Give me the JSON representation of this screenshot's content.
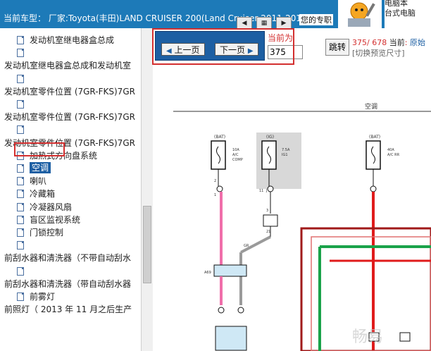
{
  "header": {
    "model_line": "当前车型：  厂家:Toyota(丰田)LAND CRUISER 200(Land Cruiser 2011-2015",
    "promo_label": "您的专职",
    "promo_lines": [
      "电脑本",
      "台式电脑"
    ]
  },
  "tree": {
    "rows": [
      {
        "label": "发动机室继电器盒总成",
        "indent": 1,
        "icon": true
      },
      {
        "label": "",
        "indent": 1,
        "icon": true
      },
      {
        "label": "发动机室继电器盒总成和发动机室",
        "indent": 0,
        "icon": false
      },
      {
        "label": "",
        "indent": 1,
        "icon": true
      },
      {
        "label": "发动机室零件位置 (7GR-FKS)7GR",
        "indent": 0,
        "icon": false
      },
      {
        "label": "",
        "indent": 1,
        "icon": true
      },
      {
        "label": "发动机室零件位置 (7GR-FKS)7GR",
        "indent": 0,
        "icon": false
      },
      {
        "label": "",
        "indent": 1,
        "icon": true
      },
      {
        "label": "发动机室零件位置 (7GR-FKS)7GR",
        "indent": 0,
        "icon": false
      },
      {
        "label": "加热式方向盘系统",
        "indent": 1,
        "icon": true
      },
      {
        "label": "空调",
        "indent": 1,
        "icon": true,
        "selected": true
      },
      {
        "label": "喇叭",
        "indent": 1,
        "icon": true
      },
      {
        "label": "冷藏箱",
        "indent": 1,
        "icon": true
      },
      {
        "label": "冷凝器风扇",
        "indent": 1,
        "icon": true
      },
      {
        "label": "盲区监视系统",
        "indent": 1,
        "icon": true
      },
      {
        "label": "门锁控制",
        "indent": 1,
        "icon": true
      },
      {
        "label": "",
        "indent": 1,
        "icon": true
      },
      {
        "label": "前刮水器和清洗器（不带自动刮水",
        "indent": 0,
        "icon": false
      },
      {
        "label": "",
        "indent": 1,
        "icon": true
      },
      {
        "label": "前刮水器和清洗器（带自动刮水器",
        "indent": 0,
        "icon": false
      },
      {
        "label": "前雾灯",
        "indent": 1,
        "icon": true
      },
      {
        "label": "前照灯（ 2013 年 11 月之后生产",
        "indent": 0,
        "icon": false
      }
    ]
  },
  "pager": {
    "prev_label": "上一页",
    "next_label": "下一页",
    "current_label": "当前为",
    "current_page": "375",
    "jump_label": "跳转",
    "status_current": "375",
    "status_total": "678",
    "status_prefix": "当前",
    "status_name": "原始",
    "switch_size_label": "[切换预览尺寸]"
  },
  "schematic": {
    "title": "空调",
    "fuse_labels": [
      "(BAT)",
      "(IG)",
      "(BAT)"
    ],
    "fuse1_text": [
      "10A",
      "A/C",
      "COMP"
    ],
    "fuse2_text": [
      "7.5A",
      "IG1"
    ],
    "fuse3_text": [
      "40A",
      "A/C RR"
    ],
    "wire_colors": {
      "pink": "#f06eaa",
      "gray": "#9a9a9a",
      "red": "#e01b1b",
      "green": "#1aa34a",
      "dark_red": "#a01a1a"
    },
    "small_labels": [
      "2",
      "1",
      "11",
      "J",
      "3",
      "21",
      "A69",
      "GR",
      "B",
      "9",
      "3",
      "7",
      "GR",
      "L",
      "P",
      "GR"
    ],
    "watermark": "畅易"
  },
  "colors": {
    "header_bg": "#1d7ab8",
    "pager_bg": "#1d5fa3",
    "highlight": "#d32f2f"
  }
}
